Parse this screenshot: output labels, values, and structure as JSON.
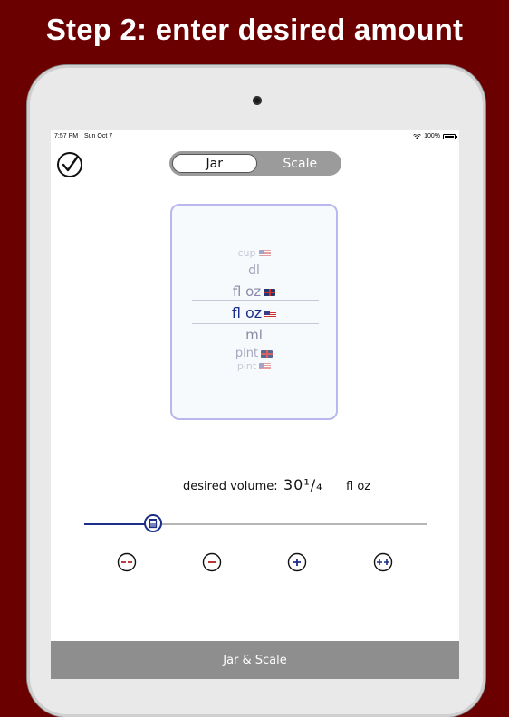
{
  "headline": "Step 2: enter desired amount",
  "status": {
    "time": "7:57 PM",
    "date": "Sun Oct 7",
    "battery": "100%"
  },
  "icons": {
    "check": "checkmark-circle-icon",
    "wifi": "wifi-icon",
    "battery": "battery-icon",
    "thumb": "jar-icon"
  },
  "segments": [
    {
      "label": "Jar",
      "active": true
    },
    {
      "label": "Scale",
      "active": false
    }
  ],
  "picker": {
    "items": [
      {
        "label": "cup",
        "flag": "us"
      },
      {
        "label": "dl",
        "flag": ""
      },
      {
        "label": "fl oz",
        "flag": "uk"
      },
      {
        "label": "fl oz",
        "flag": "us",
        "selected": true
      },
      {
        "label": "ml",
        "flag": ""
      },
      {
        "label": "pint",
        "flag": "uk"
      },
      {
        "label": "pint",
        "flag": "us"
      }
    ]
  },
  "volume": {
    "label": "desired volume:",
    "value": "30¹/₄",
    "unit": "fl oz"
  },
  "slider": {
    "level": 0.2
  },
  "buttons": {
    "large_decrease": "−−",
    "decrease": "−",
    "increase": "+",
    "large_increase": "++"
  },
  "footer": {
    "title": "Jar & Scale"
  },
  "colors": {
    "background": "#6b0000",
    "accent": "#1a2e8a",
    "negative": "#b02020",
    "footer": "#8e8e8e"
  }
}
